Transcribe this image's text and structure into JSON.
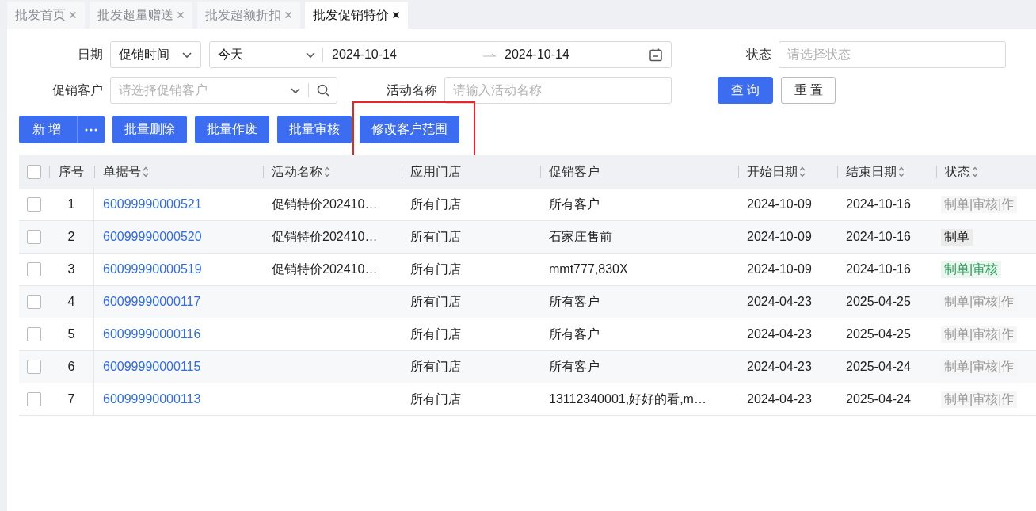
{
  "tabs": [
    {
      "label": "批发首页",
      "selected": false
    },
    {
      "label": "批发超量赠送",
      "selected": false
    },
    {
      "label": "批发超额折扣",
      "selected": false
    },
    {
      "label": "批发促销特价",
      "selected": true
    }
  ],
  "filters": {
    "date": {
      "label": "日期",
      "mode": "促销时间",
      "preset": "今天",
      "start": "2024-10-14",
      "end": "2024-10-14"
    },
    "status": {
      "label": "状态",
      "placeholder": "请选择状态"
    },
    "customer": {
      "label": "促销客户",
      "placeholder": "请选择促销客户"
    },
    "activity_name": {
      "label": "活动名称",
      "placeholder": "请输入活动名称"
    },
    "buttons": [
      {
        "label": "查询",
        "kind": "primary"
      },
      {
        "label": "重置",
        "kind": "default"
      }
    ]
  },
  "toolbar": [
    {
      "label": "新增",
      "kind": "split",
      "highlighted": false
    },
    {
      "label": "批量删除",
      "kind": "plain",
      "highlighted": false
    },
    {
      "label": "批量作废",
      "kind": "plain",
      "highlighted": false
    },
    {
      "label": "批量审核",
      "kind": "plain",
      "highlighted": false
    },
    {
      "label": "修改客户范围",
      "kind": "plain",
      "highlighted": true
    }
  ],
  "table": {
    "select_all": {
      "checked": false
    },
    "columns": [
      {
        "label": "序号",
        "sortable": false
      },
      {
        "label": "单据号",
        "sortable": true
      },
      {
        "label": "活动名称",
        "sortable": true
      },
      {
        "label": "应用门店",
        "sortable": false
      },
      {
        "label": "促销客户",
        "sortable": false
      },
      {
        "label": "开始日期",
        "sortable": true
      },
      {
        "label": "结束日期",
        "sortable": true
      },
      {
        "label": "状态",
        "sortable": true
      }
    ],
    "rows": [
      {
        "checked": false,
        "index": "1",
        "doc_no": "60099990000521",
        "activity": "促销特价202410…",
        "store": "所有门店",
        "customer": "所有客户",
        "start": "2024-10-09",
        "end": "2024-10-16",
        "status": "制单|审核|作",
        "color": "#999999"
      },
      {
        "checked": false,
        "index": "2",
        "doc_no": "60099990000520",
        "activity": "促销特价202410…",
        "store": "所有门店",
        "customer": "石家庄售前",
        "start": "2024-10-09",
        "end": "2024-10-16",
        "status": "制单",
        "color": "#222222"
      },
      {
        "checked": false,
        "index": "3",
        "doc_no": "60099990000519",
        "activity": "促销特价202410…",
        "store": "所有门店",
        "customer": "mmt777,830X",
        "start": "2024-10-09",
        "end": "2024-10-16",
        "status": "制单|审核",
        "color": "#2aa05a"
      },
      {
        "checked": false,
        "index": "4",
        "doc_no": "60099990000117",
        "store": "所有门店",
        "customer": "所有客户",
        "start": "2024-04-23",
        "end": "2025-04-25",
        "status": "制单|审核|作",
        "color": "#999999"
      },
      {
        "checked": false,
        "index": "5",
        "doc_no": "60099990000116",
        "store": "所有门店",
        "customer": "所有客户",
        "start": "2024-04-23",
        "end": "2025-04-25",
        "status": "制单|审核|作",
        "color": "#999999"
      },
      {
        "checked": false,
        "index": "6",
        "doc_no": "60099990000115",
        "store": "所有门店",
        "customer": "所有客户",
        "start": "2024-04-23",
        "end": "2025-04-24",
        "status": "制单|审核|作",
        "color": "#999999"
      },
      {
        "checked": false,
        "index": "7",
        "doc_no": "60099990000113",
        "store": "所有门店",
        "customer": "13112340001,好好的看,m…",
        "start": "2024-04-23",
        "end": "2025-04-24",
        "status": "制单|审核|作",
        "color": "#999999"
      }
    ]
  }
}
